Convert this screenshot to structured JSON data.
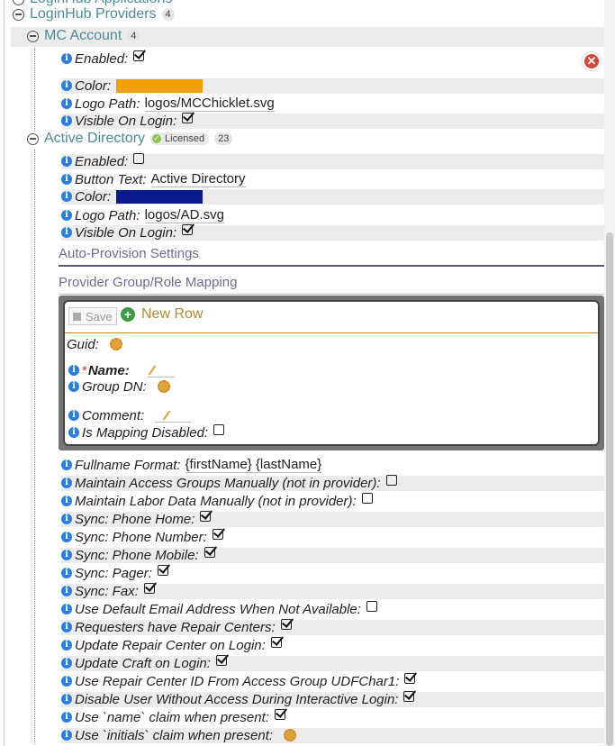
{
  "tree": {
    "partial_top": "LoginHub Applications",
    "providers": {
      "label": "LoginHub Providers",
      "count": "4"
    },
    "mc_account": {
      "label": "MC Account",
      "count": "4"
    },
    "active_directory": {
      "label": "Active Directory",
      "badge": "Licensed",
      "count": "23"
    }
  },
  "mc": {
    "enabled_label": "Enabled:",
    "enabled": true,
    "color_label": "Color:",
    "color": "#f0a000",
    "logo_label": "Logo Path:",
    "logo_value": "logos/MCChicklet.svg",
    "visible_label": "Visible On Login:",
    "visible": true
  },
  "ad": {
    "enabled_label": "Enabled:",
    "enabled": false,
    "button_label": "Button Text:",
    "button_value": "Active Directory",
    "color_label": "Color:",
    "color": "#0a1a8c",
    "logo_label": "Logo Path:",
    "logo_value": "logos/AD.svg",
    "visible_label": "Visible On Login:",
    "visible": true
  },
  "sections": {
    "auto_provision": "Auto-Provision Settings",
    "group_mapping": "Provider Group/Role Mapping"
  },
  "editor": {
    "save_label": "Save",
    "new_row_label": "New Row",
    "guid_label": "Guid:",
    "name_label": "Name:",
    "required_mark": "*",
    "group_dn_label": "Group DN:",
    "comment_label": "Comment:",
    "mapping_disabled_label": "Is Mapping Disabled:"
  },
  "settings": {
    "fullname_label": "Fullname Format:",
    "fullname_value": "{firstName} {lastName}",
    "items": [
      {
        "label": "Maintain Access Groups Manually (not in provider):",
        "checked": false
      },
      {
        "label": "Maintain Labor Data Manually (not in provider):",
        "checked": false
      },
      {
        "label": "Sync: Phone Home:",
        "checked": true
      },
      {
        "label": "Sync: Phone Number:",
        "checked": true
      },
      {
        "label": "Sync: Phone Mobile:",
        "checked": true
      },
      {
        "label": "Sync: Pager:",
        "checked": true
      },
      {
        "label": "Sync: Fax:",
        "checked": true
      },
      {
        "label": "Use Default Email Address When Not Available:",
        "checked": false
      },
      {
        "label": "Requesters have Repair Centers:",
        "checked": true
      },
      {
        "label": "Update Repair Center on Login:",
        "checked": true
      },
      {
        "label": "Update Craft on Login:",
        "checked": true
      },
      {
        "label": "Use Repair Center ID From Access Group UDFChar1:",
        "checked": true
      },
      {
        "label": "Disable User Without Access During Interactive Login:",
        "checked": true
      },
      {
        "label": "Use `name` claim when present:",
        "checked": true
      }
    ],
    "last_label": "Use `initials` claim when present:"
  }
}
